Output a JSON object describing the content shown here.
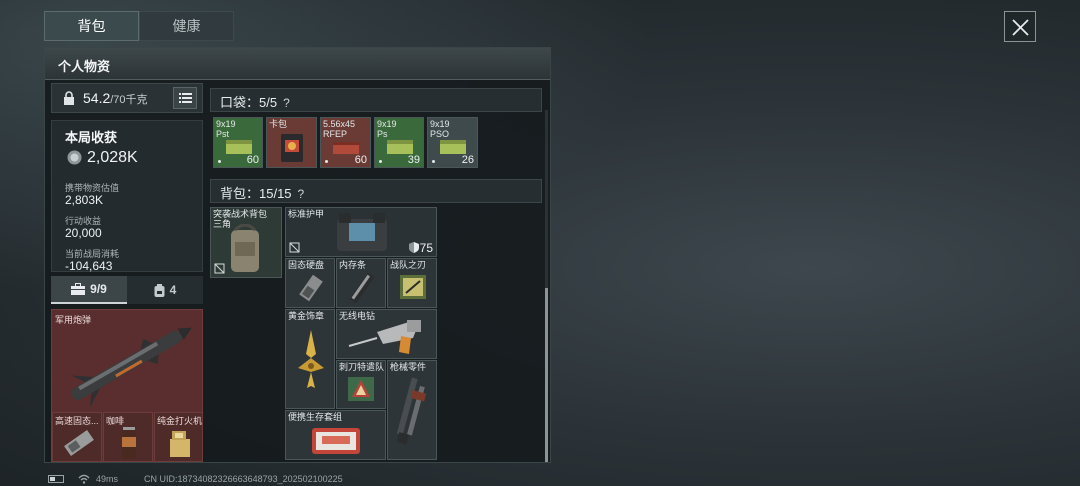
{
  "tabs": [
    {
      "label": "背包",
      "active": true
    },
    {
      "label": "健康",
      "active": false
    }
  ],
  "panel": {
    "title": "个人物资"
  },
  "weight": {
    "current": "54.2",
    "max": "/70千克"
  },
  "stats": {
    "gain_title": "本局收获",
    "gain_value": "2,028K",
    "rows": [
      {
        "label": "携带物资估值",
        "value": "2,803K"
      },
      {
        "label": "行动收益",
        "value": "20,000"
      },
      {
        "label": "当前战局消耗",
        "value": "-104,643"
      }
    ]
  },
  "container_tabs": [
    {
      "icon": "briefcase-icon",
      "label": "9/9",
      "active": true
    },
    {
      "icon": "backpack-icon",
      "label": "4",
      "active": false
    }
  ],
  "safebox": {
    "weapon_label": "军用炮弹",
    "sub_items": [
      {
        "label": "高速固态...",
        "icon": "ssd-icon"
      },
      {
        "label": "咖啡",
        "icon": "coffee-can-icon"
      },
      {
        "label": "纯金打火机",
        "icon": "lighter-icon"
      }
    ]
  },
  "pocket": {
    "header": "口袋：5/5",
    "items": [
      {
        "label": "9x19\nPst",
        "qty": "60",
        "color": "#3a6a3b"
      },
      {
        "label": "卡包",
        "qty": "",
        "color": "#6a3a34"
      },
      {
        "label": "5.56x45\nRFEP",
        "qty": "60",
        "color": "#6a3a34"
      },
      {
        "label": "9x19\nPs",
        "qty": "39",
        "color": "#3a6a3b"
      },
      {
        "label": "9x19\nPSO",
        "qty": "26",
        "color": "#3e4a4c"
      }
    ]
  },
  "backpack": {
    "header": "背包：15/15",
    "items": {
      "assault_pack": "突袭战术背包",
      "assault_pack_sub": "三角",
      "armor": "标准护甲",
      "armor_value": "75",
      "ssd": "固态硬盘",
      "ram": "内存条",
      "blade": "战队之刃",
      "medal": "黄金饰章",
      "drill": "无线电钻",
      "bayonet": "刺刀特遣队",
      "gun_parts": "枪械零件",
      "survival_kit": "便携生存套组"
    }
  },
  "status_bar": {
    "ping": "49ms",
    "uid": "CN UID:18734082326663648793_202502100225"
  },
  "close_icon": "close-icon"
}
